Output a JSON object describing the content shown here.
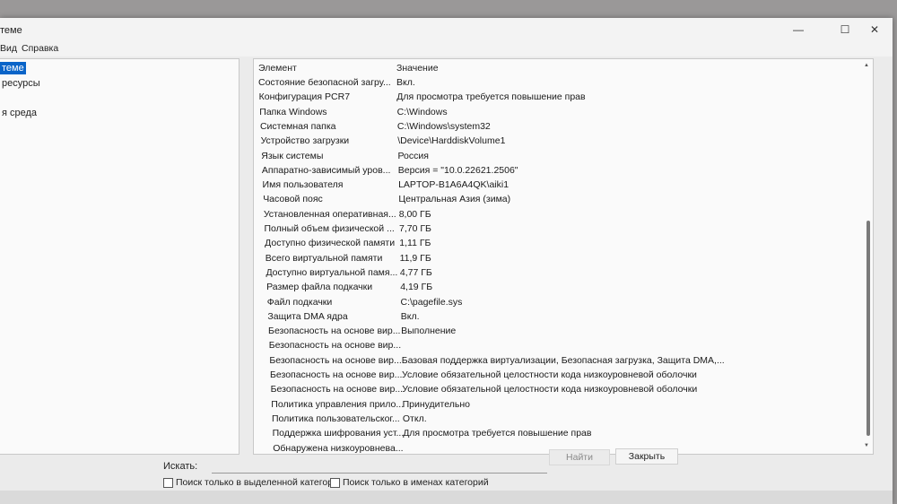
{
  "window": {
    "title": "теме",
    "controls": {
      "minimize": "—",
      "maximize": "☐",
      "close": "✕"
    }
  },
  "menu": {
    "items": [
      "Вид",
      "Справка"
    ]
  },
  "tree": {
    "items": [
      {
        "label": "теме",
        "selected": true
      },
      {
        "label": "ресурсы",
        "selected": false
      },
      {
        "label": "я среда",
        "selected": false
      }
    ]
  },
  "table": {
    "headers": {
      "name": "Элемент",
      "value": "Значение"
    },
    "rows": [
      {
        "name": "Состояние безопасной загру...",
        "value": "Вкл."
      },
      {
        "name": "Конфигурация PCR7",
        "value": "Для просмотра требуется повышение прав"
      },
      {
        "name": "Папка Windows",
        "value": "C:\\Windows"
      },
      {
        "name": "Системная папка",
        "value": "C:\\Windows\\system32"
      },
      {
        "name": "Устройство загрузки",
        "value": "\\Device\\HarddiskVolume1"
      },
      {
        "name": "Язык системы",
        "value": "Россия"
      },
      {
        "name": "Аппаратно-зависимый уров...",
        "value": "Версия = \"10.0.22621.2506\""
      },
      {
        "name": "Имя пользователя",
        "value": "LAPTOP-B1A6A4QK\\aiki1"
      },
      {
        "name": "Часовой пояс",
        "value": "Центральная Азия (зима)"
      },
      {
        "name": "Установленная оперативная...",
        "value": "8,00 ГБ"
      },
      {
        "name": "Полный объем физической ...",
        "value": "7,70 ГБ"
      },
      {
        "name": "Доступно физической памяти",
        "value": "1,11 ГБ"
      },
      {
        "name": "Всего виртуальной памяти",
        "value": "11,9 ГБ"
      },
      {
        "name": "Доступно виртуальной памя...",
        "value": "4,77 ГБ"
      },
      {
        "name": "Размер файла подкачки",
        "value": "4,19 ГБ"
      },
      {
        "name": "Файл подкачки",
        "value": "C:\\pagefile.sys"
      },
      {
        "name": "Защита DMA ядра",
        "value": "Вкл."
      },
      {
        "name": "Безопасность на основе вир...",
        "value": "Выполнение"
      },
      {
        "name": "Безопасность на основе вир...",
        "value": ""
      },
      {
        "name": "Безопасность на основе вир...",
        "value": "Базовая поддержка виртуализации, Безопасная загрузка, Защита DMA,..."
      },
      {
        "name": "Безопасность на основе вир...",
        "value": "Условие обязательной целостности кода низкоуровневой оболочки"
      },
      {
        "name": "Безопасность на основе вир...",
        "value": "Условие обязательной целостности кода низкоуровневой оболочки"
      },
      {
        "name": "Политика управления прило...",
        "value": "Принудительно"
      },
      {
        "name": "Политика пользовательског...",
        "value": "Откл."
      },
      {
        "name": "Поддержка шифрования уст...",
        "value": "Для просмотра требуется повышение прав"
      },
      {
        "name": "Обнаружена низкоуровнева...",
        "value": ""
      }
    ]
  },
  "search": {
    "label": "Искать:",
    "value": "",
    "find_button": "Найти",
    "close_button": "Закрыть",
    "check_selected_category": "Поиск только в выделенной категори",
    "check_category_names": "Поиск только в именах категорий"
  },
  "colors": {
    "selection": "#0a64c8",
    "pane_bg": "#fafafa",
    "window_bg": "#ebebeb"
  }
}
